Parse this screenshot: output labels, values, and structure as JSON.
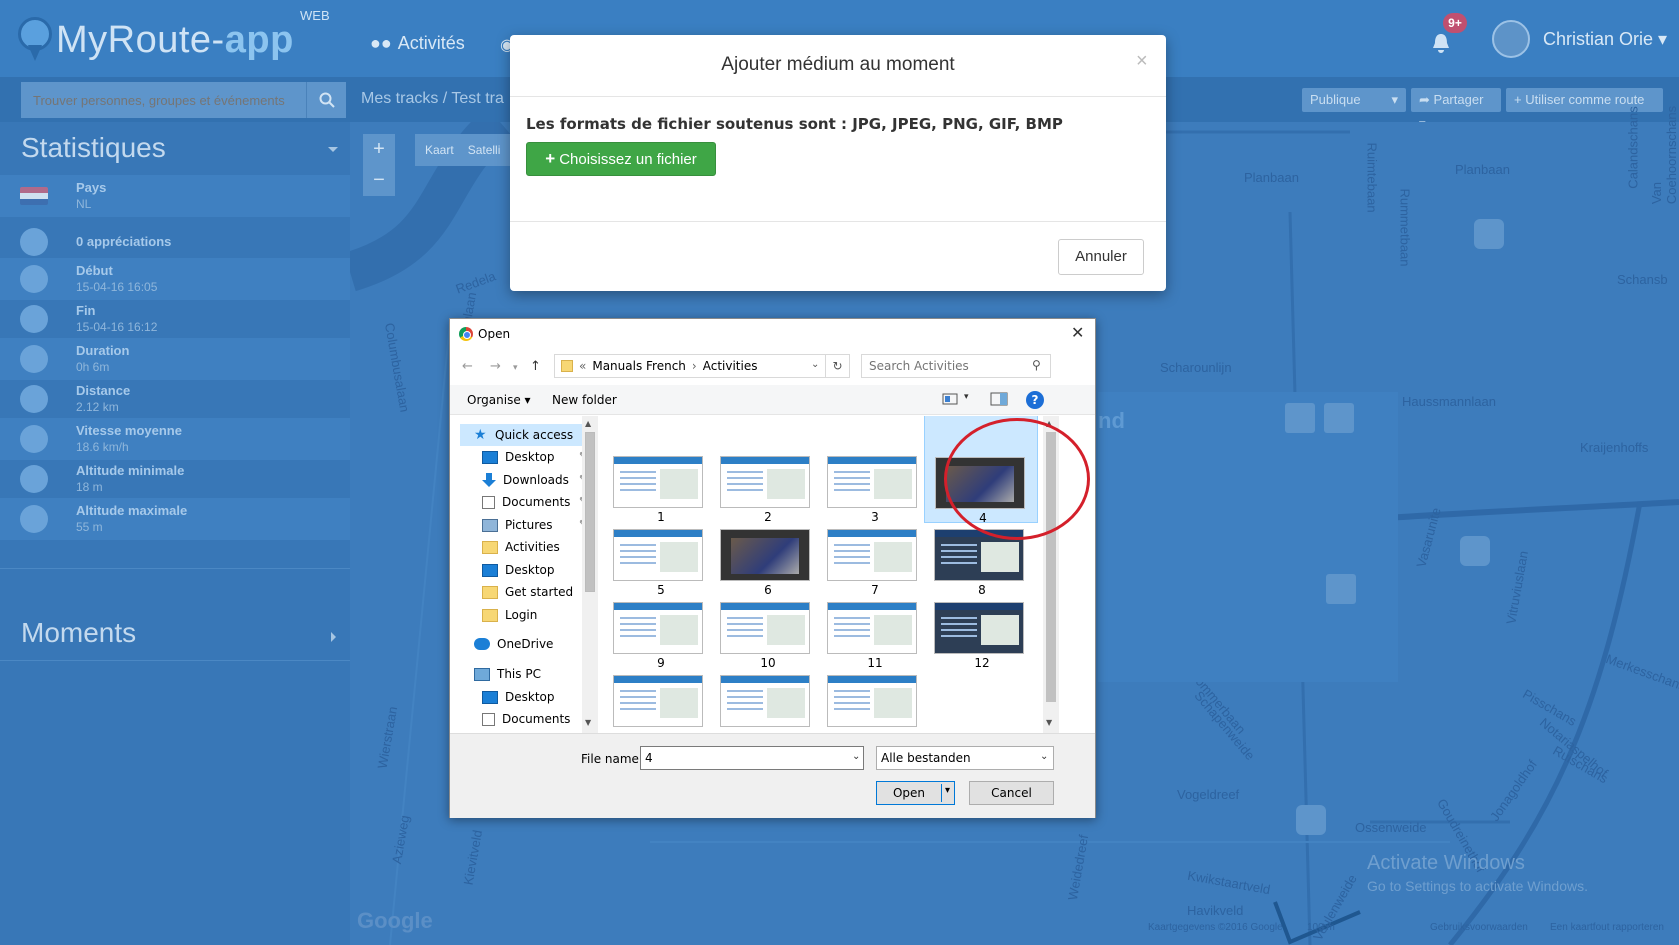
{
  "app": {
    "logo_main": "MyRoute-",
    "logo_accent": "app",
    "logo_sup": "WEB",
    "nav_activities": "Activités",
    "notifications_badge": "9+",
    "user_name": "Christian Orie"
  },
  "subbar": {
    "search_placeholder": "Trouver personnes, groupes et événements",
    "breadcrumb_1": "Mes tracks",
    "breadcrumb_sep": "/",
    "breadcrumb_2": "Test tra",
    "visibility": "Publique",
    "share": "Partager",
    "use_as_route": "Utiliser comme route"
  },
  "sidebar": {
    "stats_title": "Statistiques",
    "moments_title": "Moments",
    "stats": [
      {
        "label": "Pays",
        "value": "NL"
      },
      {
        "label": "0 appréciations",
        "value": ""
      },
      {
        "label": "Début",
        "value": "15-04-16 16:05"
      },
      {
        "label": "Fin",
        "value": "15-04-16 16:12"
      },
      {
        "label": "Duration",
        "value": "0h 6m"
      },
      {
        "label": "Distance",
        "value": "2.12 km"
      },
      {
        "label": "Vitesse moyenne",
        "value": "18.6 km/h"
      },
      {
        "label": "Altitude minimale",
        "value": "18 m"
      },
      {
        "label": "Altitude maximale",
        "value": "55 m"
      }
    ]
  },
  "map": {
    "zoom_in": "+",
    "zoom_out": "−",
    "type_map": "Kaart",
    "type_sat": "Satelli",
    "labels": [
      "Planbaan",
      "Planbaan",
      "Schansb",
      "Redela",
      "Scharounlijn",
      "Haussmannlaan",
      "Kraijenhoffs",
      "Merkesschans",
      "Lommerbaan",
      "Ruimtebaan",
      "Vasarunite",
      "Vogeldreef",
      "Kwikstaartveld",
      "Havikveld",
      "Ossenweide",
      "Veulenweide",
      "Goudreinethof",
      "Jonagoldhof",
      "Notariaspelhof",
      "Pisschans",
      "Ruischans",
      "Columbusalaan",
      "Argonautenlaan",
      "Azieweg",
      "Wierstraan",
      "Kievitveld",
      "Weidedreef",
      "Calandschans",
      "Van Coehoornschans",
      "Schapenweide",
      "Rummetbaan",
      "Vitruviuslaan"
    ],
    "panel_title": "nd",
    "google_logo": "Google",
    "attrib_1": "Kaartgegevens ©2016 Google",
    "attrib_2": "100 m",
    "attrib_3": "Gebruiksvoorwaarden",
    "attrib_4": "Een kaartfout rapporteren",
    "activate_1": "Activate Windows",
    "activate_2": "Go to Settings to activate Windows."
  },
  "modal": {
    "title": "Ajouter médium au moment",
    "close": "×",
    "formats": "Les formats de fichier soutenus sont : JPG, JPEG, PNG, GIF, BMP",
    "choose_button": "Choisissez un fichier",
    "cancel_button": "Annuler"
  },
  "file_dialog": {
    "title": "Open",
    "close": "✕",
    "path_prefix": "«",
    "path": [
      "Manuals French",
      "Activities"
    ],
    "search_placeholder": "Search Activities",
    "organise": "Organise",
    "new_folder": "New folder",
    "tree": [
      {
        "label": "Quick access",
        "icon": "star-icon",
        "selected": true,
        "pinned": false
      },
      {
        "label": "Desktop",
        "icon": "desktop-icon",
        "selected": false,
        "pinned": true
      },
      {
        "label": "Downloads",
        "icon": "download-icon",
        "selected": false,
        "pinned": true
      },
      {
        "label": "Documents",
        "icon": "document-icon",
        "selected": false,
        "pinned": true
      },
      {
        "label": "Pictures",
        "icon": "pictures-icon",
        "selected": false,
        "pinned": true
      },
      {
        "label": "Activities",
        "icon": "folder-icon",
        "selected": false,
        "pinned": false
      },
      {
        "label": "Desktop",
        "icon": "desktop-icon",
        "selected": false,
        "pinned": false
      },
      {
        "label": "Get started",
        "icon": "folder-icon",
        "selected": false,
        "pinned": false
      },
      {
        "label": "Login",
        "icon": "folder-icon",
        "selected": false,
        "pinned": false
      },
      {
        "label": "OneDrive",
        "icon": "cloud-icon",
        "selected": false,
        "pinned": false
      },
      {
        "label": "This PC",
        "icon": "computer-icon",
        "selected": false,
        "pinned": false
      },
      {
        "label": "Desktop",
        "icon": "desktop-icon",
        "selected": false,
        "pinned": false
      },
      {
        "label": "Documents",
        "icon": "document-icon",
        "selected": false,
        "pinned": false
      }
    ],
    "files": [
      {
        "label": "1",
        "kind": "screen"
      },
      {
        "label": "2",
        "kind": "screen"
      },
      {
        "label": "3",
        "kind": "screen"
      },
      {
        "label": "4",
        "kind": "photo",
        "selected": true
      },
      {
        "label": "5",
        "kind": "screen"
      },
      {
        "label": "6",
        "kind": "photo"
      },
      {
        "label": "7",
        "kind": "screen"
      },
      {
        "label": "8",
        "kind": "dark"
      },
      {
        "label": "9",
        "kind": "screen"
      },
      {
        "label": "10",
        "kind": "screen"
      },
      {
        "label": "11",
        "kind": "screen"
      },
      {
        "label": "12",
        "kind": "dark"
      },
      {
        "label": "",
        "kind": "screen"
      },
      {
        "label": "",
        "kind": "screen"
      },
      {
        "label": "",
        "kind": "screen"
      }
    ],
    "file_name_label": "File name:",
    "file_name_value": "4",
    "file_type": "Alle bestanden",
    "open_button": "Open",
    "cancel_button": "Cancel"
  }
}
